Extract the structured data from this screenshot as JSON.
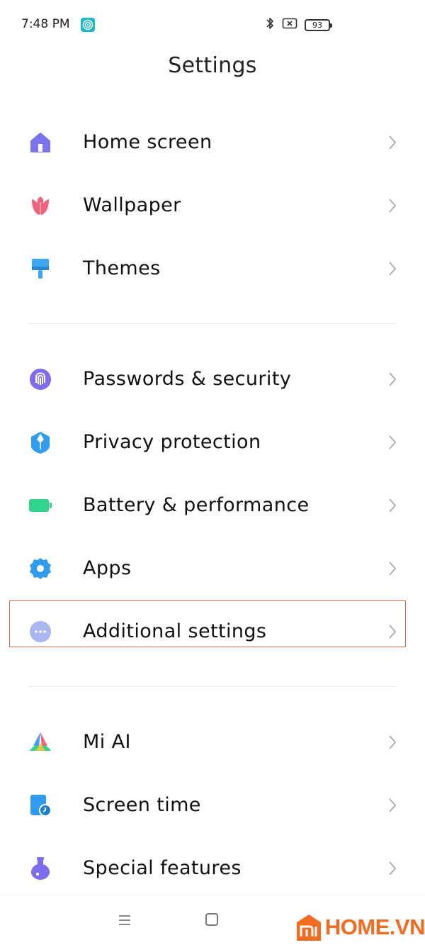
{
  "status_bar": {
    "time": "7:48 PM",
    "battery_level": "93"
  },
  "page": {
    "title": "Settings"
  },
  "groups": [
    {
      "items": [
        {
          "label": "Home screen",
          "icon": "home-icon",
          "color": "#7b74f0"
        },
        {
          "label": "Wallpaper",
          "icon": "tulip-icon",
          "color": "#f2607a"
        },
        {
          "label": "Themes",
          "icon": "paintbrush-icon",
          "color": "#3ba7f5"
        }
      ]
    },
    {
      "items": [
        {
          "label": "Passwords & security",
          "icon": "fingerprint-icon",
          "color": "#7d6cf0"
        },
        {
          "label": "Privacy protection",
          "icon": "shield-icon",
          "color": "#2f9cf0"
        },
        {
          "label": "Battery & performance",
          "icon": "battery-icon",
          "color": "#2fd58a"
        },
        {
          "label": "Apps",
          "icon": "gear-icon",
          "color": "#2f9cf0"
        },
        {
          "label": "Additional settings",
          "icon": "more-dots-icon",
          "color": "#a9b6ef",
          "highlighted": true
        }
      ]
    },
    {
      "items": [
        {
          "label": "Mi AI",
          "icon": "mi-ai-icon",
          "color": "#3ea0f7"
        },
        {
          "label": "Screen time",
          "icon": "screen-time-icon",
          "color": "#2f9cf0"
        },
        {
          "label": "Special features",
          "icon": "flask-icon",
          "color": "#7b6cf0"
        }
      ]
    }
  ],
  "watermark": {
    "text": "HOME.VN",
    "color": "#f36b21"
  }
}
